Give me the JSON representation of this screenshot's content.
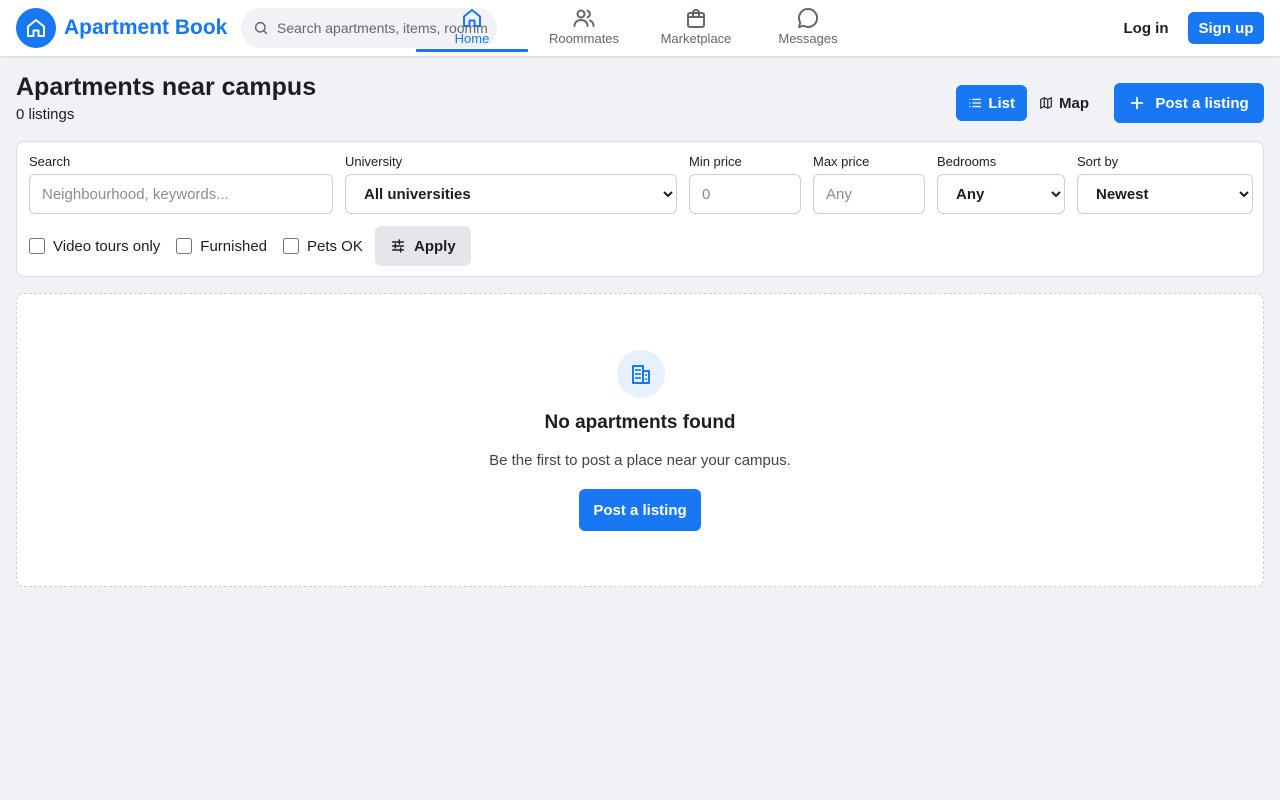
{
  "header": {
    "brand": "Apartment Book",
    "search_placeholder": "Search apartments, items, roommates",
    "nav": [
      {
        "label": "Home",
        "icon": "home-icon",
        "active": true
      },
      {
        "label": "Roommates",
        "icon": "users-icon",
        "active": false
      },
      {
        "label": "Marketplace",
        "icon": "shopping-bag-icon",
        "active": false
      },
      {
        "label": "Messages",
        "icon": "message-circle-icon",
        "active": false
      }
    ],
    "login_label": "Log in",
    "signup_label": "Sign up"
  },
  "page": {
    "title": "Apartments near campus",
    "count": "0 listings",
    "view_list_label": "List",
    "view_map_label": "Map",
    "post_label": "Post a listing"
  },
  "filters": {
    "search_label": "Search",
    "search_placeholder": "Neighbourhood, keywords...",
    "university_label": "University",
    "university_value": "All universities",
    "min_price_label": "Min price",
    "min_price_placeholder": "0",
    "max_price_label": "Max price",
    "max_price_placeholder": "Any",
    "bedrooms_label": "Bedrooms",
    "bedrooms_value": "Any",
    "sort_label": "Sort by",
    "sort_value": "Newest",
    "video_tours_label": "Video tours only",
    "furnished_label": "Furnished",
    "pets_label": "Pets OK",
    "apply_label": "Apply"
  },
  "empty": {
    "title": "No apartments found",
    "subtitle": "Be the first to post a place near your campus.",
    "button_label": "Post a listing"
  },
  "colors": {
    "accent": "#1877f2",
    "background": "#f0f2f5"
  }
}
